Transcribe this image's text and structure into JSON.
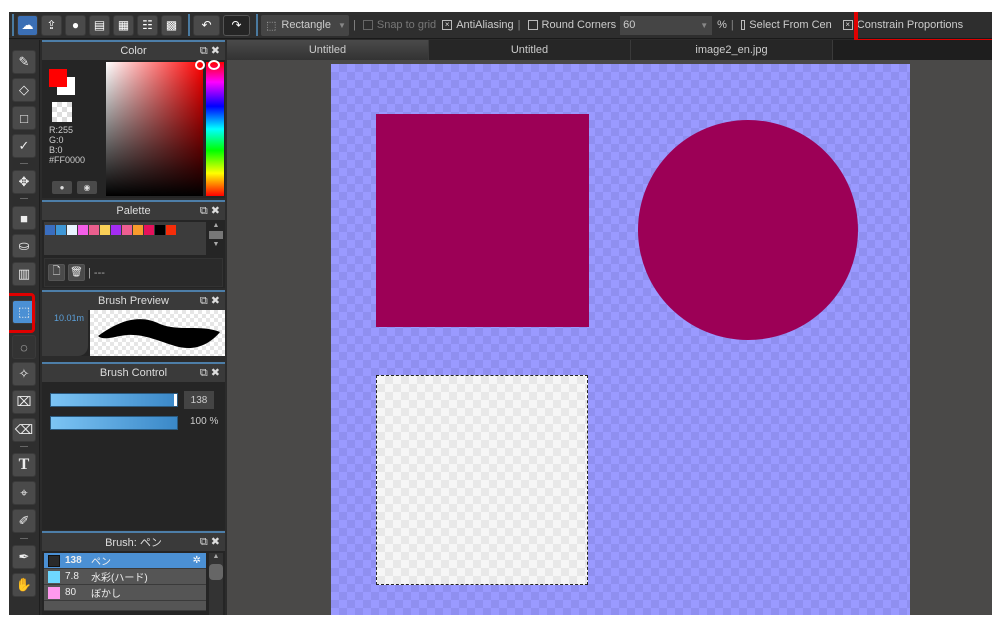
{
  "toolbar": {
    "buttons": [
      {
        "name": "cloud-icon",
        "glyph": "☁"
      },
      {
        "name": "share-icon",
        "glyph": "⇪"
      },
      {
        "name": "comment-icon",
        "glyph": "●"
      },
      {
        "name": "message-icon",
        "glyph": "▤"
      },
      {
        "name": "document-icon",
        "glyph": "▦"
      },
      {
        "name": "layer-settings-icon",
        "glyph": "☷"
      },
      {
        "name": "grid-edit-icon",
        "glyph": "▩"
      }
    ],
    "undo_glyph": "↶",
    "redo_glyph": "↷",
    "shape_select": {
      "icon": "⬚",
      "value": "Rectangle",
      "arrow": "▼"
    },
    "snap_to_grid": {
      "label": "Snap to grid",
      "checked": false
    },
    "antialiasing": {
      "label": "AntiAliasing",
      "checked": true
    },
    "round_corners": {
      "label": "Round Corners",
      "checked": false
    },
    "round_corners_value": "60",
    "percent_label": "%",
    "select_from_center": {
      "label": "Select From Cen",
      "checked": false
    },
    "constrain_proportions": {
      "label": "Constrain Proportions",
      "checked": true
    },
    "check_mark": "×",
    "separator": "|"
  },
  "tools": [
    {
      "name": "brush-tool",
      "glyph": "✎"
    },
    {
      "name": "eraser-tool",
      "glyph": "◇"
    },
    {
      "name": "shape-tool",
      "glyph": "□"
    },
    {
      "name": "polyline-tool",
      "glyph": "✓"
    },
    {
      "name": "move-tool",
      "glyph": "✥"
    },
    {
      "name": "fill-tool",
      "glyph": "■"
    },
    {
      "name": "bucket-tool",
      "glyph": "⛀"
    },
    {
      "name": "gradient-tool",
      "glyph": "▥"
    },
    {
      "name": "select-tool",
      "glyph": "⬚"
    },
    {
      "name": "lasso-tool",
      "glyph": "◌"
    },
    {
      "name": "magic-wand-tool",
      "glyph": "✧"
    },
    {
      "name": "select-pen-tool",
      "glyph": "⌧"
    },
    {
      "name": "select-eraser-tool",
      "glyph": "⌫"
    },
    {
      "name": "text-tool",
      "glyph": "T"
    },
    {
      "name": "operation-tool",
      "glyph": "⌖"
    },
    {
      "name": "divide-tool",
      "glyph": "✐"
    },
    {
      "name": "eyedropper-tool",
      "glyph": "✒"
    },
    {
      "name": "hand-tool",
      "glyph": "✋"
    }
  ],
  "color_panel": {
    "title": "Color",
    "r": "R:255",
    "g": "G:0",
    "b": "B:0",
    "hex": "#FF0000",
    "foreground": "#FF0000",
    "background": "#FFFFFF"
  },
  "palette_panel": {
    "title": "Palette",
    "swatches": [
      "#3a6ec0",
      "#3f97d6",
      "#e8f4ff",
      "#f35ee8",
      "#ea5f8e",
      "#f9cf57",
      "#a42cf2",
      "#ed5e91",
      "#f89b2c",
      "#e5115c",
      "#000000",
      "#f62d09"
    ],
    "palette_name": "---"
  },
  "preview_panel": {
    "title": "Brush Preview",
    "size_label": "10.01m"
  },
  "control_panel": {
    "title": "Brush Control",
    "size_value": "138",
    "opacity_value": "100 %",
    "size_fill": 1.0,
    "opacity_fill": 1.0
  },
  "brush_panel": {
    "title": "Brush: ペン",
    "items": [
      {
        "size": "138",
        "name": "ペン",
        "color": "#2a2a2a",
        "selected": true
      },
      {
        "size": "7.8",
        "name": "水彩(ハード)",
        "color": "#6ed8ff",
        "selected": false
      },
      {
        "size": "80",
        "name": "ぼかし",
        "color": "#ff99ee",
        "selected": false
      }
    ],
    "gear_glyph": "✲"
  },
  "panel_icons": "⧉ ✖",
  "tabs": [
    {
      "label": "Untitled",
      "active": true
    },
    {
      "label": "Untitled",
      "active": false
    },
    {
      "label": "image2_en.jpg",
      "active": false
    }
  ],
  "canvas": {
    "background_color": "#9a9aff",
    "shape_color": "#9c0056"
  }
}
